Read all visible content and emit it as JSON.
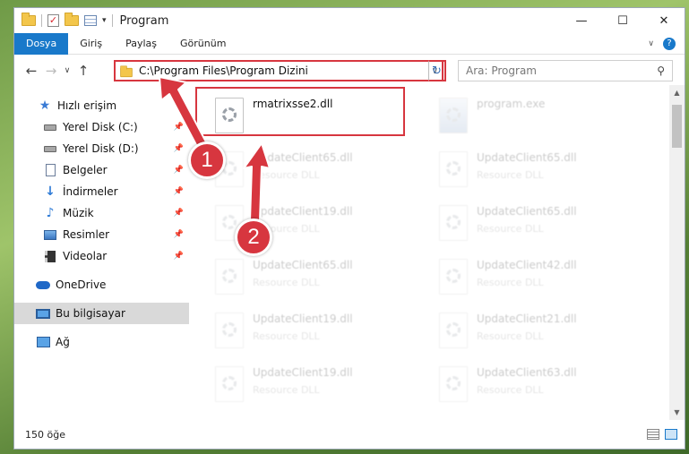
{
  "window": {
    "title": "Program",
    "minimize_icon": "minimize-icon",
    "maximize_icon": "maximize-icon",
    "close_icon": "close-icon"
  },
  "ribbon": {
    "tabs": [
      "Dosya",
      "Giriş",
      "Paylaş",
      "Görünüm"
    ],
    "active_tab": "Dosya",
    "accent": "#1979ca"
  },
  "address": {
    "path": "C:\\Program Files\\Program Dizini",
    "search_placeholder": "Ara: Program"
  },
  "sidebar": {
    "items": [
      {
        "label": "Hızlı erişim",
        "icon": "star-icon"
      },
      {
        "label": "Yerel Disk (C:)",
        "icon": "drive-icon"
      },
      {
        "label": "Yerel Disk (D:)",
        "icon": "drive-icon"
      },
      {
        "label": "Belgeler",
        "icon": "document-icon"
      },
      {
        "label": "İndirmeler",
        "icon": "download-icon"
      },
      {
        "label": "Müzik",
        "icon": "music-icon"
      },
      {
        "label": "Resimler",
        "icon": "pictures-icon"
      },
      {
        "label": "Videolar",
        "icon": "video-icon"
      },
      {
        "label": "OneDrive",
        "icon": "cloud-icon"
      },
      {
        "label": "Bu bilgisayar",
        "icon": "computer-icon"
      },
      {
        "label": "Ağ",
        "icon": "network-icon"
      }
    ],
    "selected": "Bu bilgisayar"
  },
  "files": [
    {
      "name": "rmatrixsse2.dll",
      "type": ""
    },
    {
      "name": "program.exe",
      "type": ""
    },
    {
      "name": "UpdateClient65.dll",
      "type": "Resource DLL"
    },
    {
      "name": "UpdateClient65.dll",
      "type": "Resource DLL"
    },
    {
      "name": "UpdateClient19.dll",
      "type": "Resource DLL"
    },
    {
      "name": "UpdateClient65.dll",
      "type": "Resource DLL"
    },
    {
      "name": "UpdateClient65.dll",
      "type": "Resource DLL"
    },
    {
      "name": "UpdateClient42.dll",
      "type": "Resource DLL"
    },
    {
      "name": "UpdateClient19.dll",
      "type": "Resource DLL"
    },
    {
      "name": "UpdateClient21.dll",
      "type": "Resource DLL"
    },
    {
      "name": "UpdateClient19.dll",
      "type": "Resource DLL"
    },
    {
      "name": "UpdateClient63.dll",
      "type": "Resource DLL"
    }
  ],
  "status": {
    "count": "150 öğe"
  },
  "callouts": [
    "1",
    "2"
  ],
  "highlight_color": "#d7363f"
}
